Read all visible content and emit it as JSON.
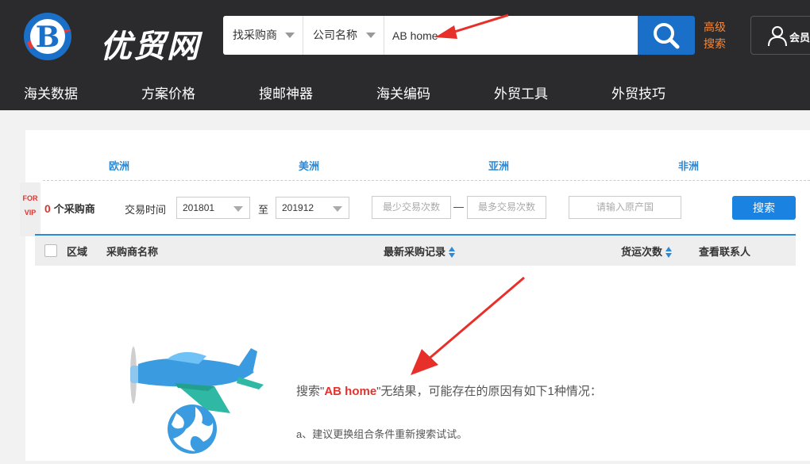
{
  "brand": {
    "name": "优贸网",
    "logo_letter": "B"
  },
  "search": {
    "type_select": "找采购商",
    "field_select": "公司名称",
    "query": "AB home",
    "advanced_line1": "高级",
    "advanced_line2": "搜索"
  },
  "member": {
    "label": "会员"
  },
  "nav": {
    "items": [
      "海关数据",
      "方案价格",
      "搜邮神器",
      "海关编码",
      "外贸工具",
      "外贸技巧"
    ]
  },
  "regions": [
    "欧洲",
    "美洲",
    "亚洲",
    "非洲"
  ],
  "vip_badge": {
    "line1": "FOR",
    "line2": "VIP"
  },
  "filters": {
    "count": "0",
    "count_suffix": "个采购商",
    "time_label": "交易时间",
    "date_from": "201801",
    "date_to": "201912",
    "to_sep": "至",
    "min_trades_placeholder": "最少交易次数",
    "range_sep": "—",
    "max_trades_placeholder": "最多交易次数",
    "origin_placeholder": "请输入原产国",
    "search_button": "搜索"
  },
  "table": {
    "headers": {
      "region": "区域",
      "buyer": "采购商名称",
      "latest": "最新采购记录",
      "shipments": "货运次数",
      "contacts": "查看联系人"
    }
  },
  "empty_state": {
    "prefix": "搜索\"",
    "keyword": "AB home",
    "suffix": "\"无结果，可能存在的原因有如下1种情况：",
    "reason": "a、建议更换组合条件重新搜索试试。"
  },
  "colors": {
    "topbar": "#2b2b2e",
    "accent_blue": "#1a6fc9",
    "accent_orange": "#f3883a",
    "red": "#e0332d",
    "arrow": "#e8302a"
  }
}
